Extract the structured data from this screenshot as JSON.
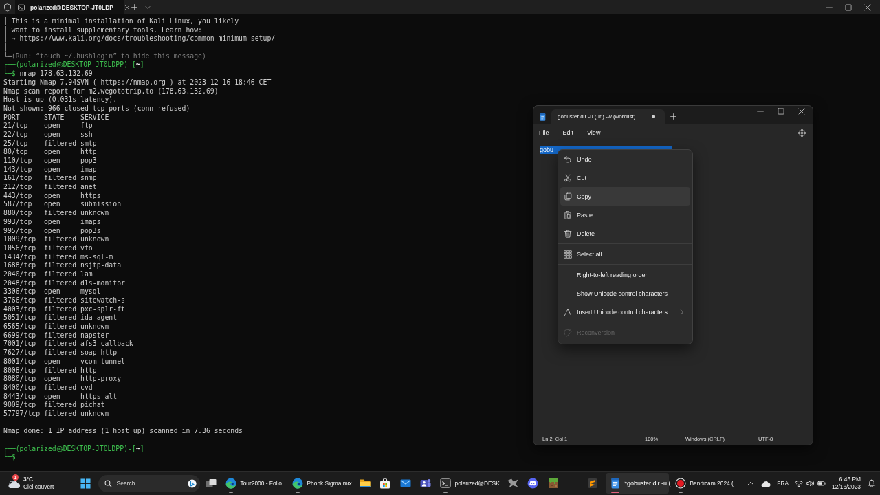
{
  "terminal": {
    "tabs": [
      {
        "title": "polarized@DESKTOP-JT0LDP",
        "selected": true
      }
    ],
    "lines": [
      {
        "kind": "banner",
        "text": "┃ This is a minimal installation of Kali Linux, you likely"
      },
      {
        "kind": "banner",
        "text": "┃ want to install supplementary tools. Learn how:"
      },
      {
        "kind": "banner",
        "text": "┃ ⇒ https://www.kali.org/docs/troubleshooting/common-minimum-setup/"
      },
      {
        "kind": "banner",
        "text": "┃"
      },
      {
        "kind": "note",
        "lead": "┗━",
        "text": "(Run: “touch ~/.hushlogin” to hide this message)"
      },
      {
        "kind": "prompt",
        "text": "┌──(polarized㉿DESKTOP-JT0LDPP)-[**~**]"
      },
      {
        "kind": "command",
        "prompt": "└─$",
        "text": "nmap 178.63.132.69"
      },
      {
        "kind": "output",
        "text": "Starting Nmap 7.94SVN ( https://nmap.org ) at 2023-12-16 18:46 CET"
      },
      {
        "kind": "output",
        "text": "Nmap scan report for m2.wegototrip.to (178.63.132.69)"
      },
      {
        "kind": "output",
        "text": "Host is up (0.031s latency)."
      },
      {
        "kind": "output",
        "text": "Not shown: 966 closed tcp ports (conn-refused)"
      },
      {
        "kind": "table",
        "columns": [
          "PORT",
          "STATE",
          "SERVICE"
        ],
        "rows": [
          [
            "21/tcp",
            "open",
            "ftp"
          ],
          [
            "22/tcp",
            "open",
            "ssh"
          ],
          [
            "25/tcp",
            "filtered",
            "smtp"
          ],
          [
            "80/tcp",
            "open",
            "http"
          ],
          [
            "110/tcp",
            "open",
            "pop3"
          ],
          [
            "143/tcp",
            "open",
            "imap"
          ],
          [
            "161/tcp",
            "filtered",
            "snmp"
          ],
          [
            "212/tcp",
            "filtered",
            "anet"
          ],
          [
            "443/tcp",
            "open",
            "https"
          ],
          [
            "587/tcp",
            "open",
            "submission"
          ],
          [
            "880/tcp",
            "filtered",
            "unknown"
          ],
          [
            "993/tcp",
            "open",
            "imaps"
          ],
          [
            "995/tcp",
            "open",
            "pop3s"
          ],
          [
            "1009/tcp",
            "filtered",
            "unknown"
          ],
          [
            "1056/tcp",
            "filtered",
            "vfo"
          ],
          [
            "1434/tcp",
            "filtered",
            "ms-sql-m"
          ],
          [
            "1688/tcp",
            "filtered",
            "nsjtp-data"
          ],
          [
            "2040/tcp",
            "filtered",
            "lam"
          ],
          [
            "2048/tcp",
            "filtered",
            "dls-monitor"
          ],
          [
            "3306/tcp",
            "open",
            "mysql"
          ],
          [
            "3766/tcp",
            "filtered",
            "sitewatch-s"
          ],
          [
            "4003/tcp",
            "filtered",
            "pxc-splr-ft"
          ],
          [
            "5051/tcp",
            "filtered",
            "ida-agent"
          ],
          [
            "6565/tcp",
            "filtered",
            "unknown"
          ],
          [
            "6699/tcp",
            "filtered",
            "napster"
          ],
          [
            "7001/tcp",
            "filtered",
            "afs3-callback"
          ],
          [
            "7627/tcp",
            "filtered",
            "soap-http"
          ],
          [
            "8001/tcp",
            "open",
            "vcom-tunnel"
          ],
          [
            "8008/tcp",
            "filtered",
            "http"
          ],
          [
            "8080/tcp",
            "open",
            "http-proxy"
          ],
          [
            "8400/tcp",
            "filtered",
            "cvd"
          ],
          [
            "8443/tcp",
            "open",
            "https-alt"
          ],
          [
            "9009/tcp",
            "filtered",
            "pichat"
          ],
          [
            "57797/tcp",
            "filtered",
            "unknown"
          ]
        ]
      },
      {
        "kind": "blank"
      },
      {
        "kind": "output",
        "text": "Nmap done: 1 IP address (1 host up) scanned in 7.36 seconds"
      },
      {
        "kind": "blank"
      },
      {
        "kind": "prompt",
        "text": "┌──(polarized㉿DESKTOP-JT0LDPP)-[**~**]"
      },
      {
        "kind": "command",
        "prompt": "└─$"
      }
    ]
  },
  "notepad": {
    "tabs": [
      {
        "title": "gobuster dir -u (url) -w (wordlist)",
        "selected": true,
        "unsaved": true
      }
    ],
    "menu": [
      "File",
      "Edit",
      "View"
    ],
    "editor": {
      "text": "gobu",
      "selected": true
    },
    "context_menu": {
      "groups": [
        {
          "items": [
            {
              "kind": "undo",
              "label": "Undo",
              "selected": false,
              "disabled": false
            },
            {
              "kind": "cut",
              "label": "Cut",
              "selected": false,
              "disabled": false
            },
            {
              "kind": "copy",
              "label": "Copy",
              "selected": true,
              "disabled": false
            },
            {
              "kind": "paste",
              "label": "Paste",
              "selected": false,
              "disabled": false
            },
            {
              "kind": "delete",
              "label": "Delete",
              "selected": false,
              "disabled": false
            }
          ]
        },
        {
          "items": [
            {
              "kind": "select_all",
              "label": "Select all",
              "selected": false,
              "disabled": false
            }
          ]
        },
        {
          "items": [
            {
              "kind": "plain",
              "label": "Right-to-left reading order",
              "selected": false,
              "disabled": false
            },
            {
              "kind": "plain",
              "label": "Show Unicode control characters",
              "selected": false,
              "disabled": false
            },
            {
              "kind": "insert",
              "label": "Insert Unicode control characters",
              "selected": false,
              "disabled": false,
              "submenu": true
            }
          ]
        },
        {
          "items": [
            {
              "kind": "reconvert",
              "label": "Reconversion",
              "selected": false,
              "disabled": true
            }
          ]
        }
      ]
    },
    "status_bar": [
      "Ln 2, Col 1",
      "100%",
      "Windows (CRLF)",
      "UTF-8"
    ]
  },
  "taskbar": {
    "weather": {
      "badge": "1",
      "temperature": "3°C",
      "condition": "Ciel couvert"
    },
    "search": {
      "placeholder": "Search"
    },
    "apps": [
      {
        "kind": "edge",
        "label": "Tour2000 - Follo",
        "running": true,
        "selected": false
      },
      {
        "kind": "edge",
        "label": "Phonk Sigma mix",
        "running": true,
        "selected": false
      },
      {
        "kind": "explorer",
        "running": false,
        "selected": false
      },
      {
        "kind": "store",
        "running": false,
        "selected": false
      },
      {
        "kind": "mail",
        "running": false,
        "selected": false
      },
      {
        "kind": "teams",
        "running": false,
        "selected": false
      },
      {
        "kind": "terminal",
        "label": "polarized@DESK",
        "running": true,
        "selected": false
      },
      {
        "kind": "game",
        "running": false,
        "selected": false
      },
      {
        "kind": "discord",
        "running": false,
        "selected": false
      },
      {
        "kind": "minecraft",
        "running": false,
        "selected": false
      },
      {
        "kind": "sublime",
        "running": false,
        "selected": false
      },
      {
        "kind": "notepad",
        "label": "*gobuster dir -u (",
        "running": true,
        "selected": true
      },
      {
        "kind": "bandicam",
        "label": "Bandicam 2024 (",
        "running": true,
        "selected": false
      }
    ],
    "tray": {
      "language": "FRA",
      "time": "6:46 PM",
      "date": "12/16/2023"
    }
  }
}
